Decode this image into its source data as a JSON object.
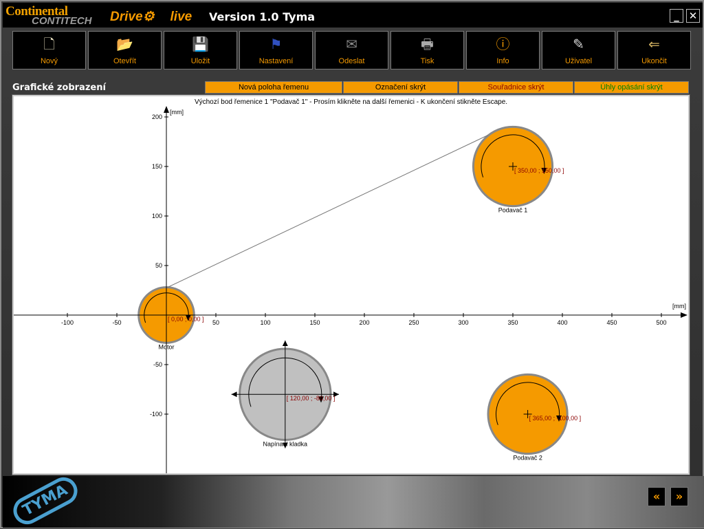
{
  "window": {
    "brand_top": "Continental",
    "brand_bottom": "CONTITECH",
    "product_left": "Drive",
    "product_right": "live",
    "title": "Version 1.0  Tyma",
    "minimize": "_",
    "close": "✕"
  },
  "toolbar": [
    {
      "label": "Nový",
      "icon": "new-document-icon",
      "glyph": "🗋"
    },
    {
      "label": "Otevřít",
      "icon": "open-folder-icon",
      "glyph": "📂"
    },
    {
      "label": "Uložit",
      "icon": "save-disk-icon",
      "glyph": "💾"
    },
    {
      "label": "Nastavení",
      "icon": "language-flags-icon",
      "glyph": "⚑"
    },
    {
      "label": "Odeslat",
      "icon": "send-mail-icon",
      "glyph": "✉"
    },
    {
      "label": "Tisk",
      "icon": "printer-icon",
      "glyph": "🖶"
    },
    {
      "label": "Info",
      "icon": "info-icon",
      "glyph": "ⓘ"
    },
    {
      "label": "Uživatel",
      "icon": "user-edit-icon",
      "glyph": "✎"
    },
    {
      "label": "Ukončit",
      "icon": "exit-door-icon",
      "glyph": "⇐"
    }
  ],
  "section_title": "Grafické zobrazení",
  "tabs": [
    {
      "label": "Nová poloha řemenu",
      "color": "#000000"
    },
    {
      "label": "Označení skrýt",
      "color": "#000000"
    },
    {
      "label": "Souřadnice skrýt",
      "color": "#8b0000"
    },
    {
      "label": "Úhly opásání skrýt",
      "color": "#008000"
    }
  ],
  "canvas": {
    "message": "Výchozí bod řemenice 1 \"Podavač 1\"  - Prosím klikněte na další řemenici - K ukončení stikněte Escape.",
    "x_unit": "[mm]",
    "y_unit": "[mm]",
    "x_ticks": [
      -100,
      -50,
      50,
      100,
      150,
      200,
      250,
      300,
      350,
      400,
      450,
      500
    ],
    "y_ticks": [
      -100,
      -50,
      50,
      100,
      150,
      200
    ],
    "pulleys": [
      {
        "name": "Motor",
        "x": 0,
        "y": 0,
        "coord": "[ 0,00 ; 0,00 ]",
        "diameter": 56,
        "color": "#f59a00",
        "type": "drive"
      },
      {
        "name": "Podavač 1",
        "x": 350,
        "y": 150,
        "coord": "[ 350,00 ; 150,00 ]",
        "diameter": 80,
        "color": "#f59a00",
        "type": "drive"
      },
      {
        "name": "Napínací kladka",
        "x": 120,
        "y": -80,
        "coord": "[ 120,00 ; -80,00 ]",
        "diameter": 92,
        "color": "#c0c0c0",
        "type": "tensioner"
      },
      {
        "name": "Podavač 2",
        "x": 365,
        "y": -100,
        "coord": "[ 365,00 ; -100,00 ]",
        "diameter": 80,
        "color": "#f59a00",
        "type": "drive"
      }
    ],
    "coord_color": "#8b0000"
  },
  "footer": {
    "logo": "TYMA",
    "prev": "«",
    "next": "»"
  }
}
